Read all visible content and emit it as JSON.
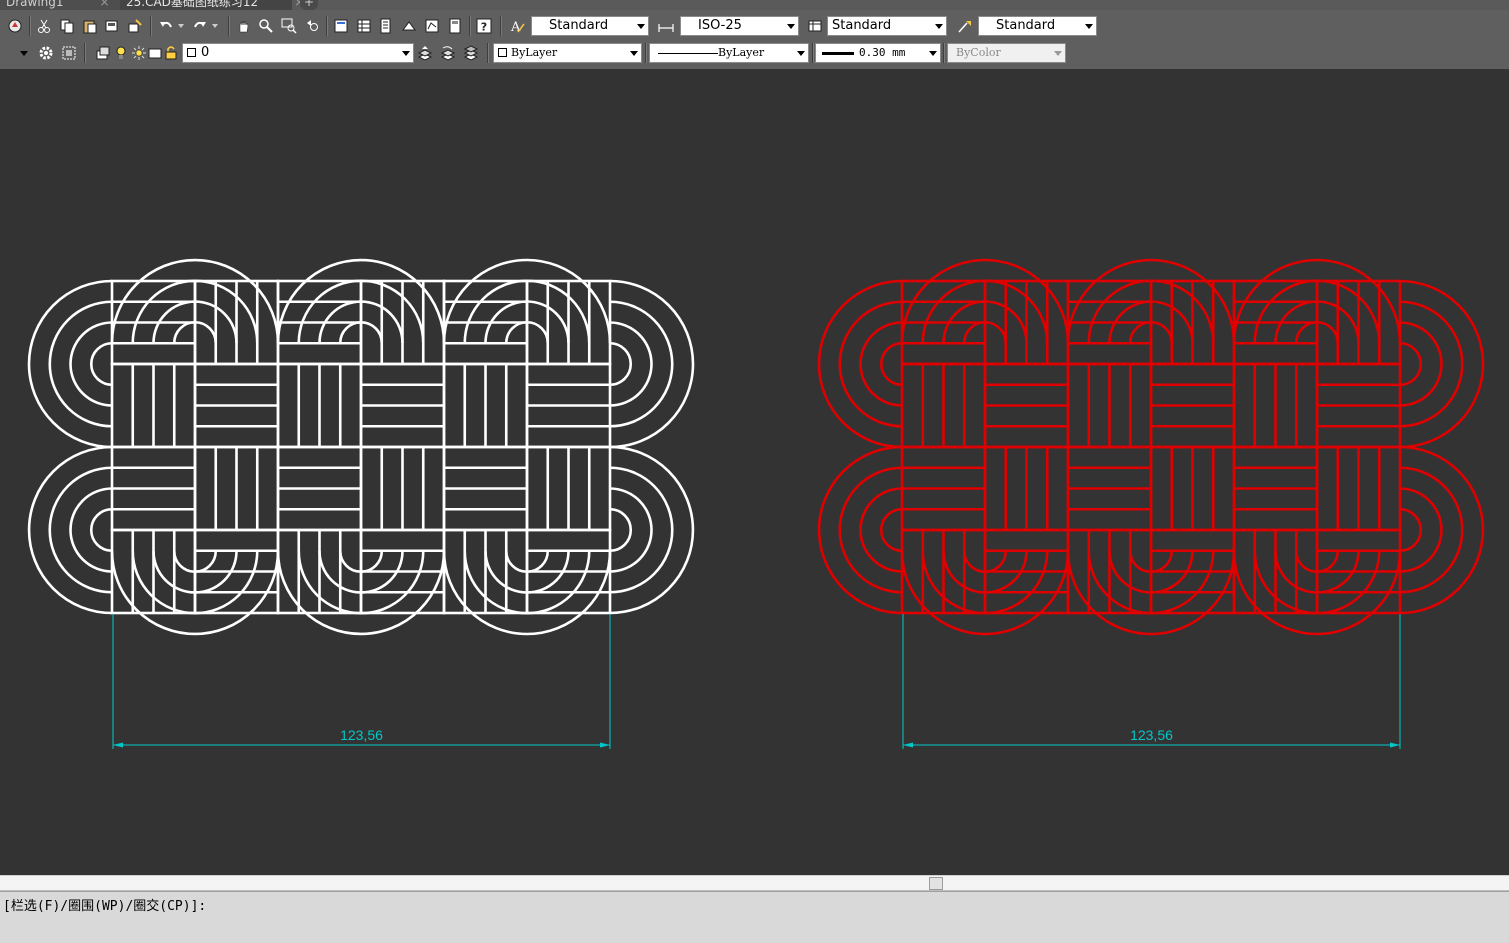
{
  "tabs": [
    {
      "label": "Drawing1",
      "close": "×"
    },
    {
      "label": "25.CAD基础图纸练习12",
      "close": "×"
    }
  ],
  "new_tab": "+",
  "toolbar": {
    "text_style": "Standard",
    "dim_style": "ISO-25",
    "table_style": "Standard",
    "multileader_style": "Standard",
    "layer": "0",
    "color": "ByLayer",
    "linetype": "ByLayer",
    "lineweight": "0.30 mm",
    "plot_style": "ByColor",
    "icons": {
      "row1": [
        "app-icon",
        "cut-icon",
        "copy-icon",
        "paste-icon",
        "match-properties-icon",
        "block-editor-icon",
        "undo-icon",
        "redo-icon",
        "pan-icon",
        "zoom-realtime-icon",
        "zoom-window-icon",
        "zoom-previous-icon",
        "properties-icon",
        "design-center-icon",
        "tool-palettes-icon",
        "sheet-set-icon",
        "markup-icon",
        "calculator-icon",
        "help-icon"
      ],
      "row2": [
        "layer-properties-icon",
        "layer-states-icon",
        "make-current-icon",
        "lightbulb-icon",
        "sun-icon",
        "lock-icon",
        "color-swatch-icon",
        "layer-previous-icon",
        "layer-isolate-icon",
        "layer-walk-icon"
      ]
    }
  },
  "drawing": {
    "left": {
      "dimension": "123,56",
      "stroke": "#ffffff"
    },
    "right": {
      "dimension": "123,56",
      "stroke": "#e00000"
    },
    "dim_color": "#00c8c8"
  },
  "command_line": "[栏选(F)/圈围(WP)/圈交(CP)]:"
}
